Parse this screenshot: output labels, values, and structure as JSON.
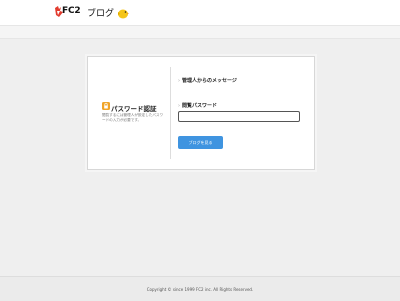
{
  "header": {
    "logo_text": "FC2",
    "logo_sub": "ブログ"
  },
  "auth": {
    "title": "パスワード認証",
    "description": "閲覧するには管理人が設定したパスワードの入力が必要です。"
  },
  "form": {
    "message_label": "管理人からのメッセージ",
    "password_label": "閲覧パスワード",
    "password_value": "",
    "submit_label": "ブログを見る"
  },
  "footer": {
    "copyright": "Copyright © since 1999 FC2 inc. All Rights Reserved."
  },
  "colors": {
    "accent": "#3f94e0",
    "page_bg": "#efefef"
  }
}
